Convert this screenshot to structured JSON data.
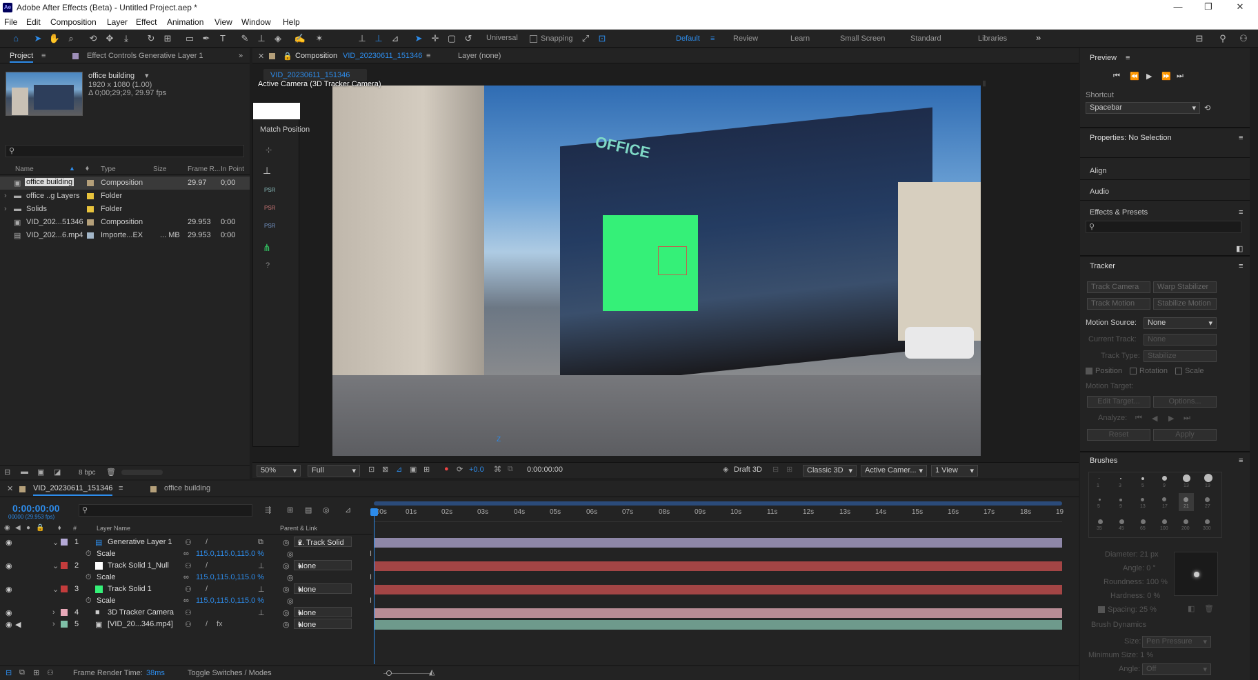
{
  "app": {
    "title": "Adobe After Effects (Beta) - Untitled Project.aep *",
    "logo": "Ae"
  },
  "window_controls": {
    "minimize": "—",
    "maximize": "❐",
    "close": "✕"
  },
  "menu": [
    "File",
    "Edit",
    "Composition",
    "Layer",
    "Effect",
    "Animation",
    "View",
    "Window",
    "Help"
  ],
  "toolbar": {
    "universal": "Universal",
    "snapping": "Snapping",
    "workspaces": [
      "Default",
      "Review",
      "Learn",
      "Small Screen",
      "Standard",
      "Libraries"
    ],
    "more": "»"
  },
  "project": {
    "tab": "Project",
    "effect_controls": "Effect Controls Generative Layer 1",
    "thumb_name": "office building",
    "thumb_res": "1920 x 1080 (1.00)",
    "thumb_dur": "Δ 0;00;29;29, 29.97 fps",
    "columns": [
      "Name",
      "Type",
      "Size",
      "Frame R...",
      "In Point"
    ],
    "items": [
      {
        "name": "office building",
        "type": "Composition",
        "size": "",
        "fps": "29.97",
        "in": "0;00",
        "color": "#b5a07a"
      },
      {
        "name": "office ..g Layers",
        "type": "Folder",
        "size": "",
        "fps": "",
        "in": "",
        "color": "#e8c33c"
      },
      {
        "name": "Solids",
        "type": "Folder",
        "size": "",
        "fps": "",
        "in": "",
        "color": "#e8c33c"
      },
      {
        "name": "VID_202...51346",
        "type": "Composition",
        "size": "",
        "fps": "29.953",
        "in": "0:00",
        "color": "#b5a07a"
      },
      {
        "name": "VID_202...6.mp4",
        "type": "Importe...EX",
        "size": "... MB",
        "fps": "29.953",
        "in": "0:00",
        "color": "#a3b7c9"
      }
    ],
    "bpc": "8 bpc"
  },
  "comp": {
    "tab_prefix": "Composition",
    "tab_name": "VID_20230611_151346",
    "layer_tab": "Layer (none)",
    "subtab": "VID_20230611_151346",
    "camera_label": "Active Camera (3D Tracker Camera)",
    "match_position": "Match Position",
    "zoom": "50%",
    "quality": "Full",
    "exposure": "+0.0",
    "timecode": "0:00:00:00",
    "draft": "Draft 3D",
    "renderer": "Classic 3D",
    "view": "Active Camer...",
    "views": "1 View",
    "axis_z": "Z",
    "sign_text": "OFFICE",
    "psr": "PSR"
  },
  "preview": {
    "title": "Preview",
    "shortcut_label": "Shortcut",
    "shortcut": "Spacebar"
  },
  "properties": {
    "title": "Properties: No Selection",
    "align": "Align",
    "audio": "Audio",
    "effects": "Effects & Presets"
  },
  "tracker": {
    "title": "Tracker",
    "track_camera": "Track Camera",
    "warp": "Warp Stabilizer",
    "track_motion": "Track Motion",
    "stabilize": "Stabilize Motion",
    "motion_source_label": "Motion Source:",
    "motion_source": "None",
    "current_track_label": "Current Track:",
    "current_track": "None",
    "track_type_label": "Track Type:",
    "track_type": "Stabilize",
    "position": "Position",
    "rotation": "Rotation",
    "scale": "Scale",
    "motion_target": "Motion Target:",
    "edit_target": "Edit Target...",
    "options": "Options...",
    "analyze": "Analyze:",
    "reset": "Reset",
    "apply": "Apply"
  },
  "brushes": {
    "title": "Brushes",
    "sizes": [
      "1",
      "3",
      "5",
      "9",
      "13",
      "19",
      "5",
      "9",
      "13",
      "17",
      "21",
      "27",
      "35",
      "45",
      "65",
      "100",
      "200",
      "300"
    ],
    "diameter": "Diameter: 21 px",
    "angle": "Angle: 0 °",
    "roundness": "Roundness: 100 %",
    "hardness": "Hardness: 0 %",
    "spacing": "Spacing: 25 %",
    "dynamics": "Brush Dynamics",
    "size_label": "Size:",
    "size_val": "Pen Pressure",
    "min_size": "Minimum Size: 1 %",
    "angle2_label": "Angle:",
    "angle2_val": "Off"
  },
  "timeline": {
    "tab": "VID_20230611_151346",
    "tab2": "office building",
    "timecode": "0:00:00:00",
    "fps": "00000 (29.953 fps)",
    "ruler": [
      ":00s",
      "01s",
      "02s",
      "03s",
      "04s",
      "05s",
      "06s",
      "07s",
      "08s",
      "09s",
      "10s",
      "11s",
      "12s",
      "13s",
      "14s",
      "15s",
      "16s",
      "17s",
      "18s",
      "19"
    ],
    "col_layer": "Layer Name",
    "col_parent": "Parent & Link",
    "layers": [
      {
        "n": "1",
        "name": "Generative Layer 1",
        "label": "#b4a9d6",
        "parent": "2. Track Solid",
        "scale": "115.0,115.0,115.0 %",
        "bar": "#8e87a8",
        "swatch": "#ffffff"
      },
      {
        "n": "2",
        "name": "Track Solid 1_Null",
        "label": "#c33c3c",
        "parent": "None",
        "scale": "115.0,115.0,115.0 %",
        "bar": "#a34545",
        "swatch": "#ffffff"
      },
      {
        "n": "3",
        "name": "Track Solid 1",
        "label": "#c33c3c",
        "parent": "None",
        "scale": "115.0,115.0,115.0 %",
        "bar": "#a34545",
        "swatch": "#35f078"
      },
      {
        "n": "4",
        "name": "3D Tracker Camera",
        "label": "#e8a8b8",
        "parent": "None",
        "bar": "#b88c95"
      },
      {
        "n": "5",
        "name": "[VID_20...346.mp4]",
        "label": "#7fc0a8",
        "parent": "None",
        "bar": "#6e9a8c"
      }
    ],
    "scale_label": "Scale",
    "fx": "fx",
    "render_time_label": "Frame Render Time:",
    "render_time": "38ms",
    "toggle": "Toggle Switches / Modes"
  }
}
